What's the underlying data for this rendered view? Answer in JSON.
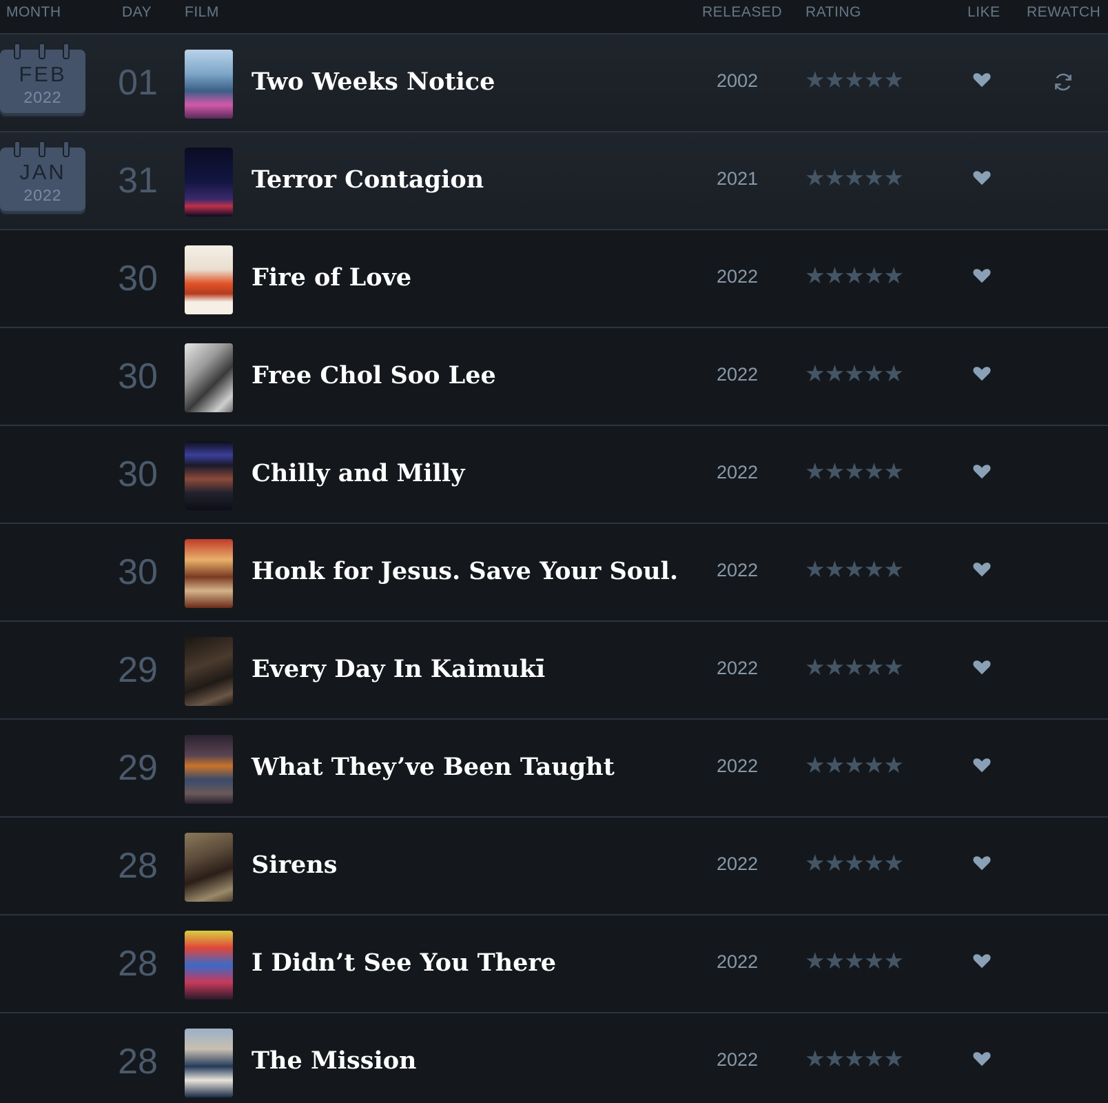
{
  "columns": {
    "month": "MONTH",
    "day": "DAY",
    "film": "FILM",
    "released": "RELEASED",
    "rating": "RATING",
    "like": "LIKE",
    "rewatch": "REWATCH"
  },
  "calendars": [
    {
      "month": "FEB",
      "year": "2022"
    },
    {
      "month": "JAN",
      "year": "2022"
    }
  ],
  "colors": {
    "background": "#14181c",
    "row_highlight": "#1f252c",
    "calendar": "#44536a",
    "star_inactive": "#445566",
    "heart": "#8aa0b6"
  },
  "rows": [
    {
      "day": "01",
      "title": "Two Weeks Notice",
      "year": "2002",
      "stars": "★★★★★",
      "icon_like": "heart-icon",
      "icon_rewatch": "rewatch-icon"
    },
    {
      "day": "31",
      "title": "Terror Contagion",
      "year": "2021",
      "stars": "★★★★★",
      "icon_like": "heart-icon"
    },
    {
      "day": "30",
      "title": "Fire of Love",
      "year": "2022",
      "stars": "★★★★★",
      "icon_like": "heart-icon"
    },
    {
      "day": "30",
      "title": "Free Chol Soo Lee",
      "year": "2022",
      "stars": "★★★★★",
      "icon_like": "heart-icon"
    },
    {
      "day": "30",
      "title": "Chilly and Milly",
      "year": "2022",
      "stars": "★★★★★",
      "icon_like": "heart-icon"
    },
    {
      "day": "30",
      "title": "Honk for Jesus. Save Your Soul.",
      "year": "2022",
      "stars": "★★★★★",
      "icon_like": "heart-icon"
    },
    {
      "day": "29",
      "title": "Every Day In Kaimukī",
      "year": "2022",
      "stars": "★★★★★",
      "icon_like": "heart-icon"
    },
    {
      "day": "29",
      "title": "What They’ve Been Taught",
      "year": "2022",
      "stars": "★★★★★",
      "icon_like": "heart-icon"
    },
    {
      "day": "28",
      "title": "Sirens",
      "year": "2022",
      "stars": "★★★★★",
      "icon_like": "heart-icon"
    },
    {
      "day": "28",
      "title": "I Didn’t See You There",
      "year": "2022",
      "stars": "★★★★★",
      "icon_like": "heart-icon"
    },
    {
      "day": "28",
      "title": "The Mission",
      "year": "2022",
      "stars": "★★★★★",
      "icon_like": "heart-icon"
    }
  ]
}
